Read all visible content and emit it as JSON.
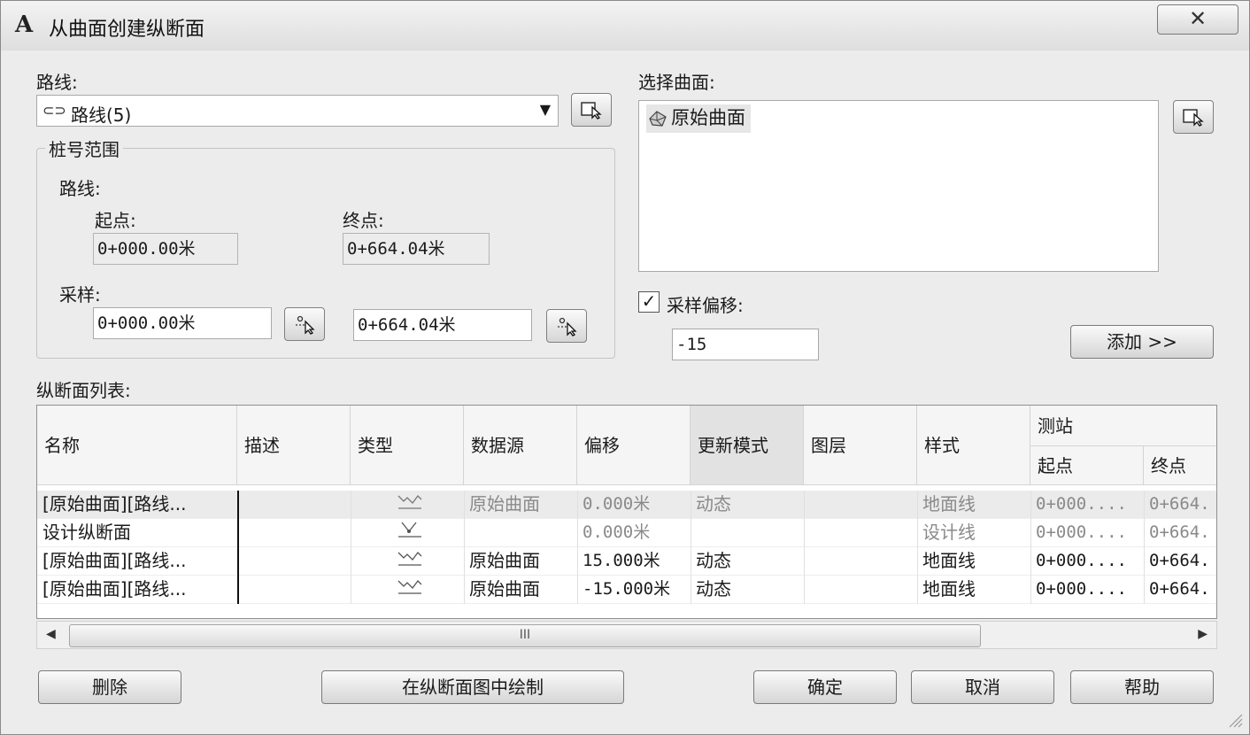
{
  "window": {
    "title": "从曲面创建纵断面",
    "close_symbol": "✕"
  },
  "alignment": {
    "label": "路线:",
    "selected": "路线(5)"
  },
  "station_range": {
    "title": "桩号范围",
    "alignment_label": "路线:",
    "start_label": "起点:",
    "end_label": "终点:",
    "start_value": "0+000.00米",
    "end_value": "0+664.04米",
    "sample_label": "采样:",
    "sample_start": "0+000.00米",
    "sample_end": "0+664.04米"
  },
  "surfaces": {
    "label": "选择曲面:",
    "items": [
      "原始曲面"
    ]
  },
  "sample_offsets": {
    "label": "采样偏移:",
    "checked": true,
    "value": "-15",
    "add_button": "添加 >>"
  },
  "profile_list": {
    "label": "纵断面列表:",
    "columns": {
      "name": "名称",
      "description": "描述",
      "type": "类型",
      "data_source": "数据源",
      "offset": "偏移",
      "update_mode": "更新模式",
      "layer": "图层",
      "style": "样式",
      "station": "测站",
      "station_start": "起点",
      "station_end": "终点"
    },
    "rows": [
      {
        "name": "[原始曲面][路线...",
        "type_icon": "surface-profile-icon",
        "data_source": "原始曲面",
        "offset": "0.000米",
        "update_mode": "动态",
        "style": "地面线",
        "start": "0+000....",
        "end": "0+664."
      },
      {
        "name": "设计纵断面",
        "type_icon": "layout-profile-icon",
        "data_source": "",
        "offset": "0.000米",
        "update_mode": "",
        "style": "设计线",
        "start": "0+000....",
        "end": "0+664."
      },
      {
        "name": "[原始曲面][路线...",
        "type_icon": "surface-profile-icon",
        "data_source": "原始曲面",
        "offset": "15.000米",
        "update_mode": "动态",
        "style": "地面线",
        "start": "0+000....",
        "end": "0+664."
      },
      {
        "name": "[原始曲面][路线...",
        "type_icon": "surface-profile-icon",
        "data_source": "原始曲面",
        "offset": "-15.000米",
        "update_mode": "动态",
        "style": "地面线",
        "start": "0+000....",
        "end": "0+664."
      }
    ],
    "scroll_thumb_grip": "III"
  },
  "buttons": {
    "delete": "删除",
    "draw_in_profile_view": "在纵断面图中绘制",
    "ok": "确定",
    "cancel": "取消",
    "help": "帮助"
  }
}
